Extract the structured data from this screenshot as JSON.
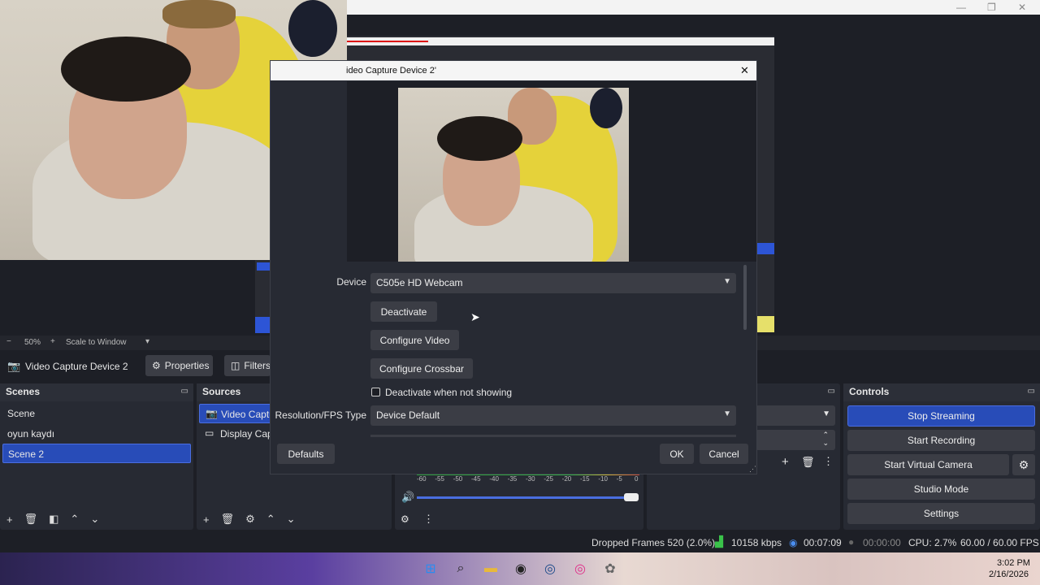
{
  "dialog": {
    "title": "ideo Capture Device 2'",
    "close": "✕",
    "device_label": "Device",
    "device_value": "C505e HD Webcam",
    "deactivate": "Deactivate",
    "configure_video": "Configure Video",
    "configure_crossbar": "Configure Crossbar",
    "deactivate_when_not_showing": "Deactivate when not showing",
    "resfps_label": "Resolution/FPS Type",
    "resfps_value": "Device Default",
    "defaults": "Defaults",
    "ok": "OK",
    "cancel": "Cancel"
  },
  "toolbar": {
    "zoom_minus": "−",
    "zoom": "50%",
    "zoom_plus": "+",
    "scale": "Scale to Window"
  },
  "source_bar": {
    "source_name": "Video Capture Device 2",
    "properties": "Properties",
    "filters": "Filters"
  },
  "scenes": {
    "title": "Scenes",
    "items": [
      "Scene",
      "oyun kaydı",
      "Scene 2"
    ],
    "selected": "Scene 2"
  },
  "sources": {
    "title": "Sources",
    "items": [
      "Video Captur",
      "Display Capt"
    ]
  },
  "mixer": {
    "scale": [
      "-60",
      "-55",
      "-50",
      "-45",
      "-40",
      "-35",
      "-30",
      "-25",
      "-20",
      "-15",
      "-10",
      "-5",
      "0"
    ]
  },
  "controls": {
    "title": "Controls",
    "stop_streaming": "Stop Streaming",
    "start_recording": "Start Recording",
    "start_virtual_camera": "Start Virtual Camera",
    "studio_mode": "Studio Mode",
    "settings": "Settings"
  },
  "status": {
    "dropped_frames": "Dropped Frames 520 (2.0%)",
    "bitrate": "10158 kbps",
    "stream_time": "00:07:09",
    "rec_time": "00:00:00",
    "cpu": "CPU: 2.7%",
    "fps": "60.00 / 60.00 FPS"
  },
  "taskbar": {
    "time": "3:02 PM",
    "date": "2/16/2026"
  },
  "colors": {
    "accent": "#284cb8",
    "panel": "#272a33",
    "button": "#3b3d45"
  }
}
